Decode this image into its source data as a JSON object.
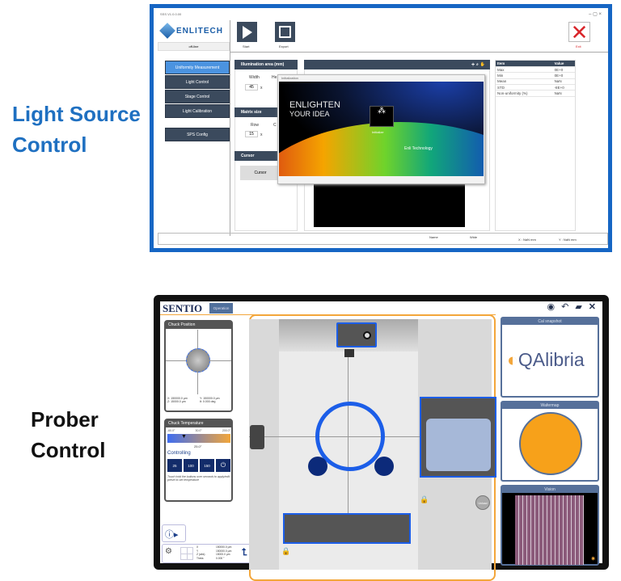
{
  "captions": {
    "light_source": [
      "Light Source",
      "Control"
    ],
    "prober": [
      "Prober",
      "Control"
    ]
  },
  "light_app": {
    "window_title": "SSS V1.0.0.00",
    "logo_text": "ENLITECH",
    "status": "off-line",
    "toolbar": {
      "start": "Start",
      "export": "Export",
      "exit": "Exit"
    },
    "nav": [
      "Uniformity Measurement",
      "Light Control",
      "Stage Control",
      "Light Calibration"
    ],
    "sps_config": "SPS Config",
    "illumination": {
      "header": "Illumination area (mm)",
      "width_label": "Width",
      "height_label": "He",
      "width_value": "45",
      "x": "x"
    },
    "matrix": {
      "header": "Matrix size",
      "row_label": "Row",
      "col_label": "C",
      "row_value": "15",
      "x": "x"
    },
    "cursor": {
      "header": "Cursor",
      "button": "Cursor"
    },
    "splash": {
      "title": "Initialization",
      "headline1": "ENLIGHTEN",
      "headline2": "YOUR IDEA",
      "init": "Initialize",
      "tech": "Enli Technology"
    },
    "results": {
      "headers": [
        "Item",
        "Value"
      ],
      "rows": [
        [
          "Max",
          "0E+0"
        ],
        [
          "Min",
          "0E+0"
        ],
        [
          "Mean",
          "NaN"
        ],
        [
          "STD",
          "-8E+0"
        ],
        [
          "Non-uniformity (%)",
          "NaN"
        ]
      ]
    },
    "statusbar": {
      "name": "Name",
      "wide": "Wide",
      "x": "X : NaN mm",
      "y": "Y : NaN mm"
    },
    "colors": {
      "frame": "#1666c4",
      "nav": "#3b4a5d",
      "active": "#4b93e0",
      "exit": "#d9262b"
    }
  },
  "prober_app": {
    "logo": "SENTIO",
    "mode_button": "Operation",
    "chuck_position": {
      "title": "Chuck Position",
      "x": "X: 150000.0 µm",
      "y": "Y: 150000.0 µm",
      "z": "Z: 15000.0 µm",
      "theta": "θ: 0.000 deg"
    },
    "chuck_temperature": {
      "title": "Chuck Temperature",
      "min": "-60.0°",
      "mid": "30.0°",
      "max": "200.0°",
      "current": "25.0°",
      "controlling": "Controlling",
      "presets": [
        "25",
        "100",
        "150"
      ],
      "hint": "Touch hold the buttons over seconds to apply/edit preset to set temperature"
    },
    "readout": {
      "labels": [
        "X",
        "Y",
        "Z (abs)",
        "Theta"
      ],
      "values": [
        "150000.0 µm",
        "150000.0 µm",
        "15000.0 µm",
        "0.000 °"
      ]
    },
    "unload": "Unload",
    "panels": {
      "cal": "Cal snapshot",
      "wafermap": "Wafermap",
      "vision": "Vision"
    },
    "cal_logo": "QAlibria",
    "colors": {
      "accent": "#f3a63a",
      "blue": "#1c5ee8",
      "wafer": "#f7a11a"
    }
  }
}
